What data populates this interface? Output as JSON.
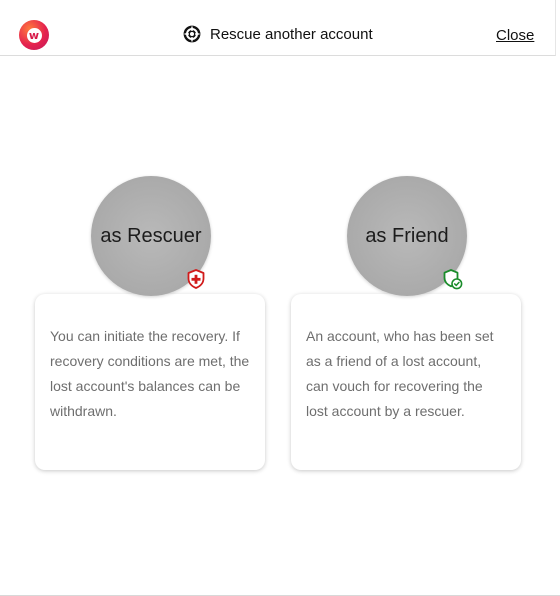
{
  "header": {
    "title": "Rescue another account",
    "close_label": "Close",
    "logo_letter": "w",
    "title_icon": "lifebuoy-icon"
  },
  "options": [
    {
      "label": "as Rescuer",
      "badge_icon": "shield-plus-icon",
      "badge_color": "#d11a1a",
      "description": "You can initiate the recovery. If recovery conditions are met, the lost account's balances can be withdrawn."
    },
    {
      "label": "as Friend",
      "badge_icon": "shield-check-icon",
      "badge_color": "#1a8c2a",
      "description": "An account, who has been set as a friend of a lost account, can vouch for recovering the lost account by a rescuer."
    }
  ],
  "colors": {
    "option_circle": "#aaaaaa",
    "body_text": "#6e6e6e",
    "logo_gradient": [
      "#ff7a3d",
      "#e5234e",
      "#c2185b"
    ]
  }
}
